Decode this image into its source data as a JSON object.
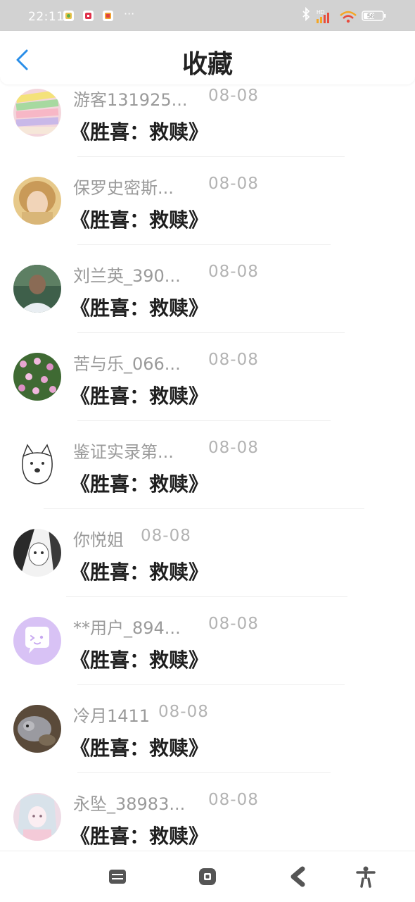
{
  "status_bar": {
    "time": "22:11",
    "dots": "···",
    "battery": "56",
    "network_label": "HD",
    "icons": [
      "bluetooth-icon",
      "signal-icon",
      "wifi-icon",
      "battery-icon"
    ]
  },
  "header": {
    "title": "收藏",
    "back_icon": "chevron-left-icon",
    "accent": "#2a8ee8"
  },
  "items": [
    {
      "name": "游客131925...",
      "date": "08-08",
      "book": "《胜喜：救赎》",
      "avatar": "avatar-books"
    },
    {
      "name": "保罗史密斯...",
      "date": "08-08",
      "book": "《胜喜：救赎》",
      "avatar": "avatar-girl-photo"
    },
    {
      "name": "刘兰英_390...",
      "date": "08-08",
      "book": "《胜喜：救赎》",
      "avatar": "avatar-woman-photo"
    },
    {
      "name": "苦与乐_066...",
      "date": "08-08",
      "book": "《胜喜：救赎》",
      "avatar": "avatar-flowers"
    },
    {
      "name": "鉴证实录第...",
      "date": "08-08",
      "book": "《胜喜：救赎》",
      "avatar": "avatar-doge-sketch"
    },
    {
      "name": "你悦姐",
      "date": "08-08",
      "book": "《胜喜：救赎》",
      "avatar": "avatar-anime-bw"
    },
    {
      "name": "**用户_894...",
      "date": "08-08",
      "book": "《胜喜：救赎》",
      "avatar": "avatar-default-purple"
    },
    {
      "name": "冷月1411",
      "date": "08-08",
      "book": "《胜喜：救赎》",
      "avatar": "avatar-animal"
    },
    {
      "name": "永坠_38983...",
      "date": "08-08",
      "book": "《胜喜：救赎》",
      "avatar": "avatar-anime-pink"
    }
  ],
  "nav_bar": {
    "icons": [
      "menu-icon",
      "home-icon",
      "back-icon",
      "accessibility-icon"
    ]
  }
}
